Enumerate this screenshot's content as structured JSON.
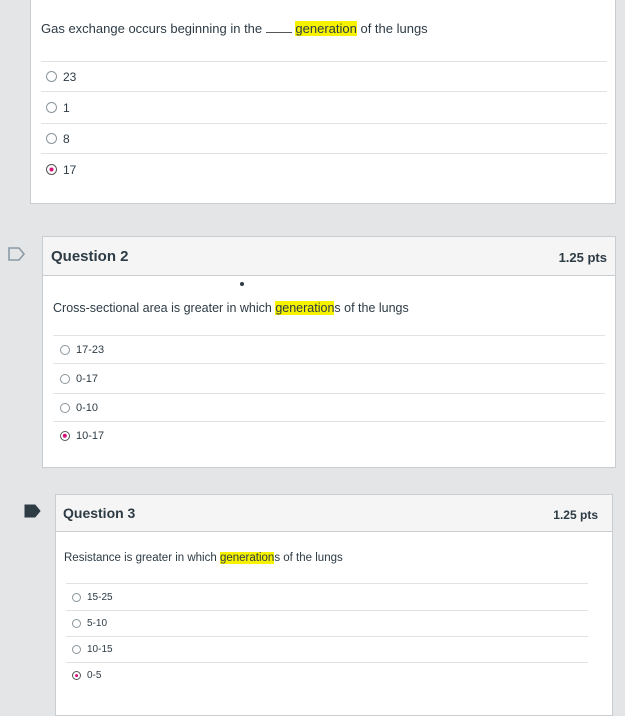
{
  "q1": {
    "text_before": "Gas exchange occurs beginning in the",
    "blank": "____",
    "text_highlight": "generation",
    "text_after": " of the lungs",
    "answers": [
      "23",
      "1",
      "8",
      "17"
    ],
    "selected": "17"
  },
  "q2": {
    "title": "Question 2",
    "points": "1.25 pts",
    "text_before": "Cross-sectional area is greater in which ",
    "text_highlight": "generation",
    "text_after": "s of the lungs",
    "answers": [
      "17-23",
      "0-17",
      "0-10",
      "10-17"
    ],
    "selected": "10-17"
  },
  "q3": {
    "title": "Question 3",
    "points": "1.25 pts",
    "text_before": "Resistance is greater in which ",
    "text_highlight": "generation",
    "text_after": "s of the lungs",
    "answers": [
      "15-25",
      "5-10",
      "10-15",
      "0-5"
    ],
    "selected": "0-5"
  },
  "colors": {
    "highlight": "#f7f200",
    "selected_radio": "#d8117c",
    "flag": "#2d3b45"
  }
}
